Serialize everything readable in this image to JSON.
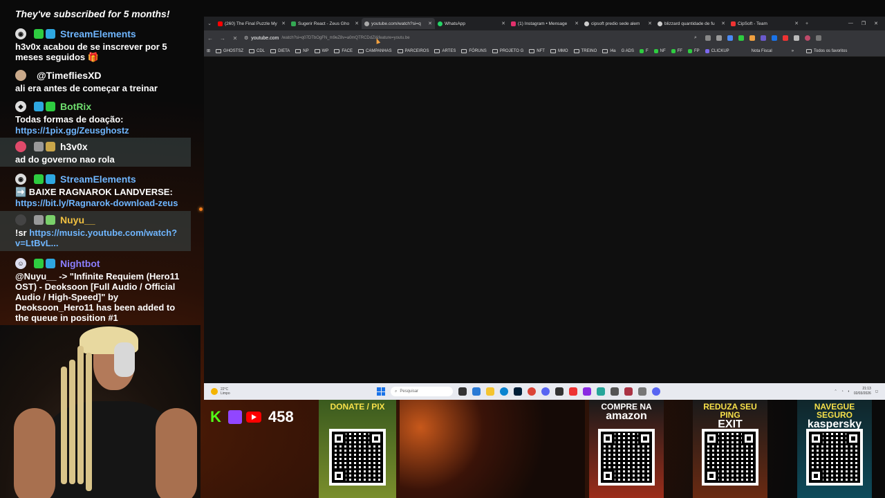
{
  "chat": {
    "header": "They've subscribed for 5 months!",
    "messages": [
      {
        "user": "StreamElements",
        "color": "#6fb6ff",
        "text": "h3v0x acabou de se inscrever por 5 meses seguidos 🎁",
        "link": ""
      },
      {
        "user": "@TimefliesXD",
        "color": "#ffffff",
        "text": "ali era antes de começar a treinar",
        "link": ""
      },
      {
        "user": "BotRix",
        "color": "#6fdf6f",
        "text": "Todas formas de doação:",
        "link": "https://1pix.gg/Zeusghostz"
      },
      {
        "user": "h3v0x",
        "color": "#ffffff",
        "text": "ad do governo nao rola",
        "link": ""
      },
      {
        "user": "StreamElements",
        "color": "#6fb6ff",
        "text": "➡️ BAIXE RAGNAROK LANDVERSE:",
        "link": "https://bit.ly/Ragnarok-download-zeus"
      },
      {
        "user": "Nuyu__",
        "color": "#f0c040",
        "text": "!sr",
        "link": "https://music.youtube.com/watch?v=LtBvL..."
      },
      {
        "user": "Nightbot",
        "color": "#8b7fff",
        "text": "@Nuyu__ -> \"Infinite Requiem (Hero11 OST) - Deoksoon [Full Audio / Official Audio / High-Speed]\" by Deoksoon_Hero11 has been added to the queue in position #1",
        "link": ""
      }
    ]
  },
  "browser": {
    "tabs": [
      {
        "title": "(260) The Final Puzzle My",
        "color": "#ff0000",
        "active": false
      },
      {
        "title": "Sugerir React - Zeus Gho",
        "color": "#34a853",
        "active": false
      },
      {
        "title": "youtube.com/watch?si=q",
        "color": "#aaaaaa",
        "active": true
      },
      {
        "title": "WhatsApp",
        "color": "#25d366",
        "active": false
      },
      {
        "title": "(1) Instagram • Mensage",
        "color": "#e1306c",
        "active": false
      },
      {
        "title": "cipsoft predio sede alem",
        "color": "#cccccc",
        "active": false
      },
      {
        "title": "blizzard quantidade de fu",
        "color": "#cccccc",
        "active": false
      },
      {
        "title": "CipSoft - Team",
        "color": "#e33",
        "active": false
      }
    ],
    "url_host": "youtube.com",
    "url_rest": "/watch?si=q07DTbOgFN_m9eZ8v=a0mQTRCDdZI&feature=youtu.be",
    "bookmarks": [
      "GHOSTSZ",
      "CDL",
      "DIETA",
      "NP",
      "WP",
      "FACE",
      "CAMPANHAS",
      "PARCEIROS",
      "ARTES",
      "FÓRUNS",
      "PROJETO G",
      "NFT",
      "MMO",
      "TREINO",
      "I4a",
      "G ADS",
      "F",
      "NF",
      "FF",
      "FP",
      "CLICKUP",
      "Nota Fiscal"
    ],
    "bookmarks_all": "Todos os favoritos"
  },
  "taskbar": {
    "weather_temp": "22°C",
    "weather_desc": "Limpo",
    "search_placeholder": "Pesquisar",
    "time": "21:13",
    "date": "02/03/2026"
  },
  "overlay": {
    "viewers": "458",
    "donate_title": "DONATE / PIX",
    "amazon_title": "COMPRE NA",
    "amazon_brand": "amazon",
    "exit_title": "REDUZA SEU PING",
    "exit_brand": "EXIT",
    "kasp_title": "NAVEGUE SEGURO",
    "kasp_brand": "kaspersky"
  }
}
